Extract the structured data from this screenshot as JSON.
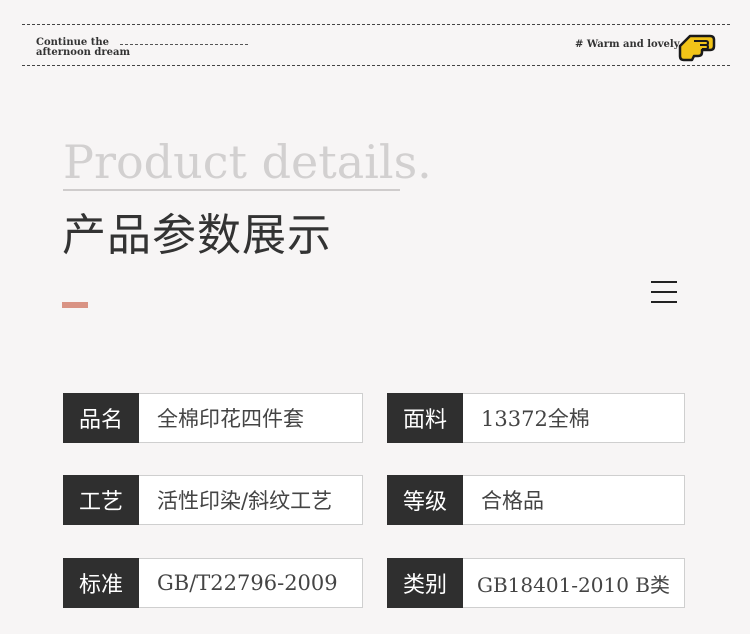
{
  "header": {
    "tagline_left_1": "Continue the",
    "tagline_left_2": "afternoon dream",
    "tagline_right": "# Warm and lovely"
  },
  "title": {
    "en": "Product details.",
    "cn": "产品参数展示"
  },
  "icons": {
    "badge": "hand-pointing-icon",
    "menu": "menu-icon"
  },
  "colors": {
    "accent": "#d99384",
    "label_bg": "#2f2f2f"
  },
  "specs": [
    {
      "label": "品名",
      "value": "全棉印花四件套"
    },
    {
      "label": "面料",
      "value": "13372全棉"
    },
    {
      "label": "工艺",
      "value": "活性印染/斜纹工艺"
    },
    {
      "label": "等级",
      "value": "合格品"
    },
    {
      "label": "标准",
      "value": "GB/T22796-2009"
    },
    {
      "label": "类别",
      "value": "GB18401-2010 B类"
    }
  ]
}
